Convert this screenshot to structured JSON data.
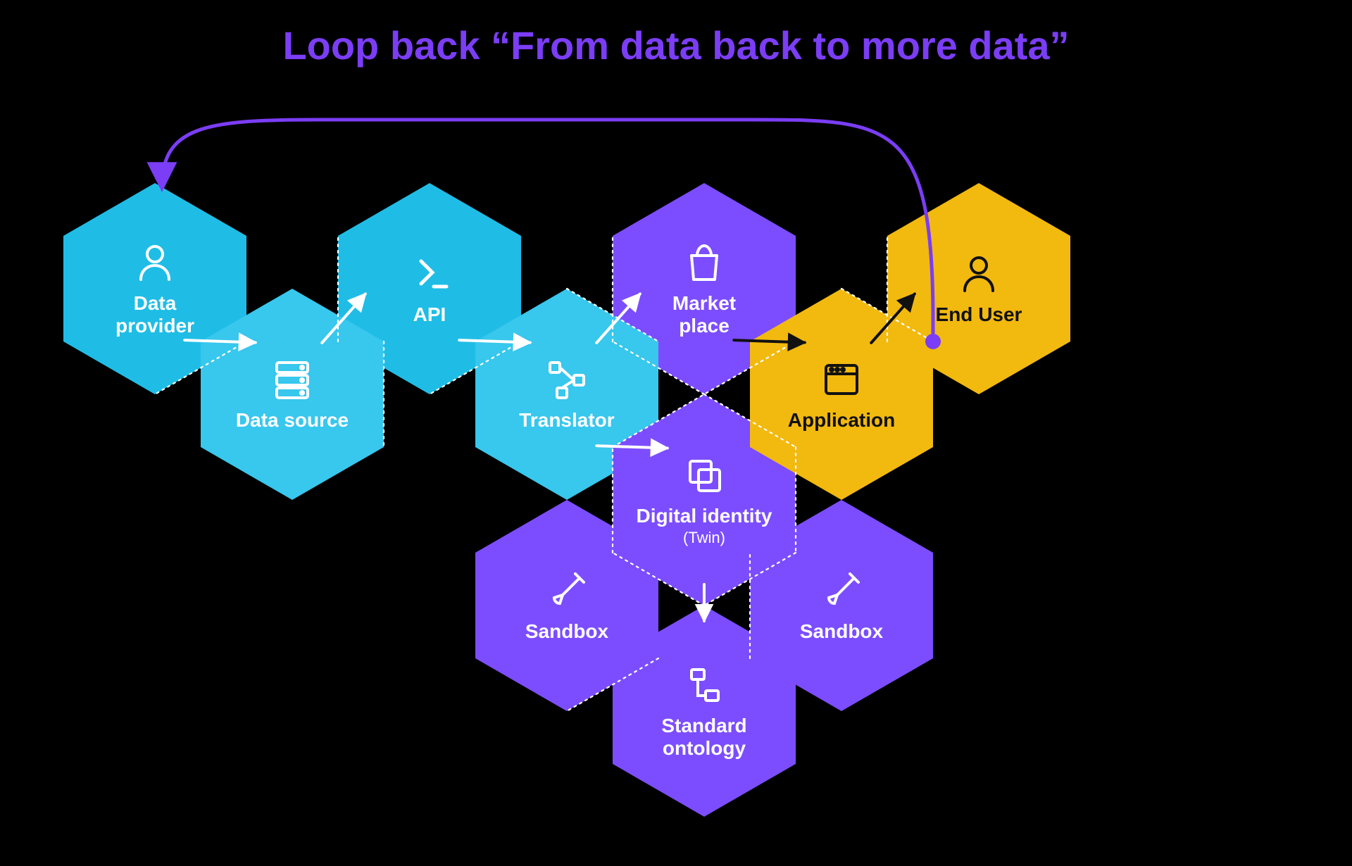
{
  "colors": {
    "cyan": "#1FBDE6",
    "cyanLight": "#38C7ED",
    "purple": "#7C4DFF",
    "purpleBright": "#7B3DF5",
    "amber": "#F2B90F",
    "accentText": "#7B3DF5",
    "black": "#000000",
    "white": "#FFFFFF"
  },
  "title": "Loop back “From data back to more data”",
  "hexes": {
    "dataProvider": {
      "label": "Data\nprovider",
      "icon": "user"
    },
    "dataSource": {
      "label": "Data source",
      "icon": "server"
    },
    "api": {
      "label": "API",
      "icon": "code"
    },
    "translator": {
      "label": "Translator",
      "icon": "network"
    },
    "marketplace": {
      "label": "Market\nplace",
      "icon": "bag"
    },
    "digitalIdentity": {
      "label": "Digital identity",
      "sublabel": "(Twin)",
      "icon": "copy"
    },
    "sandboxLeft": {
      "label": "Sandbox",
      "icon": "shovel"
    },
    "sandboxRight": {
      "label": "Sandbox",
      "icon": "shovel"
    },
    "standardOntology": {
      "label": "Standard\nontology",
      "icon": "sitemap"
    },
    "application": {
      "label": "Application",
      "icon": "window"
    },
    "endUser": {
      "label": "End User",
      "icon": "user"
    }
  }
}
